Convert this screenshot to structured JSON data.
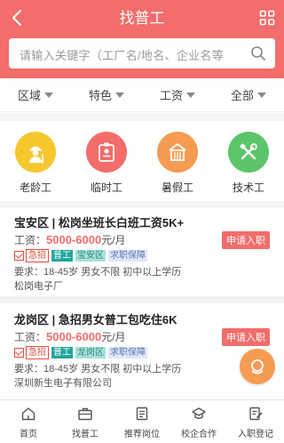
{
  "header": {
    "title": "找普工",
    "search_placeholder": "请输入关键字（工厂名/地名、企业名等"
  },
  "filters": [
    {
      "label": "区域"
    },
    {
      "label": "特色"
    },
    {
      "label": "工资"
    },
    {
      "label": "全部"
    }
  ],
  "categories": [
    {
      "label": "老龄工",
      "color": "#f7c72e",
      "icon": "elder-worker-icon"
    },
    {
      "label": "临时工",
      "color": "#f26d6b",
      "icon": "id-badge-icon"
    },
    {
      "label": "暑假工",
      "color": "#f59b52",
      "icon": "building-icon"
    },
    {
      "label": "技术工",
      "color": "#5cc56a",
      "icon": "tools-icon"
    }
  ],
  "jobs": [
    {
      "title": "宝安区 | 松岗坐班长白班工资5K+",
      "salary_prefix": "工资：",
      "salary": "5000-6000",
      "salary_unit": "元/月",
      "apply": "申请入职",
      "tags": [
        "急招",
        "普工",
        "宝安区",
        "求职保障"
      ],
      "requirements": "要求：18-45岁 男女不限 初中以上学历",
      "company": "松岗电子厂"
    },
    {
      "title": "龙岗区 | 急招男女普工包吃住6K",
      "salary_prefix": "工资：",
      "salary": "5000-6000",
      "salary_unit": "元/月",
      "apply": "申请入职",
      "tags": [
        "急招",
        "普工",
        "龙岗区",
        "求职保障"
      ],
      "requirements": "要求：18-45岁 男女不限 初中以上学历",
      "company": "深圳新生电子有限公司"
    }
  ],
  "tabbar": [
    {
      "label": "首页",
      "icon": "home-icon"
    },
    {
      "label": "找普工",
      "icon": "briefcase-icon"
    },
    {
      "label": "推荐岗位",
      "icon": "document-icon"
    },
    {
      "label": "校企合作",
      "icon": "school-icon"
    },
    {
      "label": "入职登记",
      "icon": "register-icon"
    }
  ],
  "colors": {
    "brand": "#f26d6b",
    "urgent": "#e74c3c",
    "type_tag": "#20a79c",
    "float_button": "#f59b52"
  }
}
